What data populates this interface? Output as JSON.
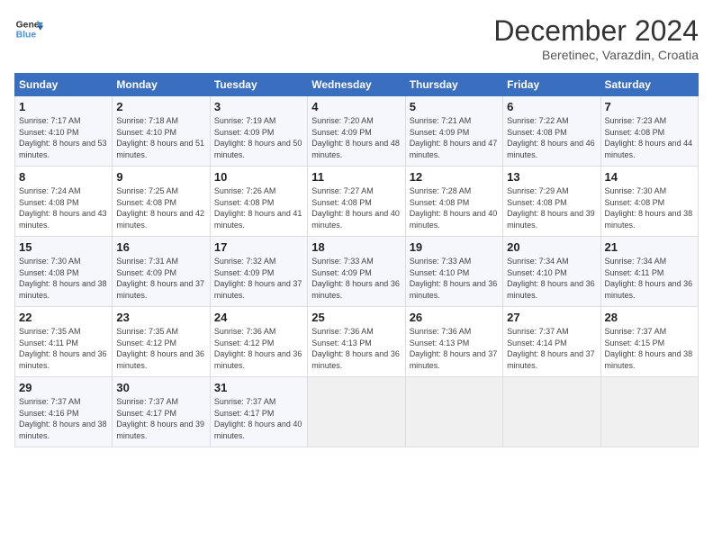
{
  "header": {
    "logo_line1": "General",
    "logo_line2": "Blue",
    "month": "December 2024",
    "location": "Beretinec, Varazdin, Croatia"
  },
  "weekdays": [
    "Sunday",
    "Monday",
    "Tuesday",
    "Wednesday",
    "Thursday",
    "Friday",
    "Saturday"
  ],
  "weeks": [
    [
      {
        "day": "1",
        "sunrise": "7:17 AM",
        "sunset": "4:10 PM",
        "daylight": "8 hours and 53 minutes."
      },
      {
        "day": "2",
        "sunrise": "7:18 AM",
        "sunset": "4:10 PM",
        "daylight": "8 hours and 51 minutes."
      },
      {
        "day": "3",
        "sunrise": "7:19 AM",
        "sunset": "4:09 PM",
        "daylight": "8 hours and 50 minutes."
      },
      {
        "day": "4",
        "sunrise": "7:20 AM",
        "sunset": "4:09 PM",
        "daylight": "8 hours and 48 minutes."
      },
      {
        "day": "5",
        "sunrise": "7:21 AM",
        "sunset": "4:09 PM",
        "daylight": "8 hours and 47 minutes."
      },
      {
        "day": "6",
        "sunrise": "7:22 AM",
        "sunset": "4:08 PM",
        "daylight": "8 hours and 46 minutes."
      },
      {
        "day": "7",
        "sunrise": "7:23 AM",
        "sunset": "4:08 PM",
        "daylight": "8 hours and 44 minutes."
      }
    ],
    [
      {
        "day": "8",
        "sunrise": "7:24 AM",
        "sunset": "4:08 PM",
        "daylight": "8 hours and 43 minutes."
      },
      {
        "day": "9",
        "sunrise": "7:25 AM",
        "sunset": "4:08 PM",
        "daylight": "8 hours and 42 minutes."
      },
      {
        "day": "10",
        "sunrise": "7:26 AM",
        "sunset": "4:08 PM",
        "daylight": "8 hours and 41 minutes."
      },
      {
        "day": "11",
        "sunrise": "7:27 AM",
        "sunset": "4:08 PM",
        "daylight": "8 hours and 40 minutes."
      },
      {
        "day": "12",
        "sunrise": "7:28 AM",
        "sunset": "4:08 PM",
        "daylight": "8 hours and 40 minutes."
      },
      {
        "day": "13",
        "sunrise": "7:29 AM",
        "sunset": "4:08 PM",
        "daylight": "8 hours and 39 minutes."
      },
      {
        "day": "14",
        "sunrise": "7:30 AM",
        "sunset": "4:08 PM",
        "daylight": "8 hours and 38 minutes."
      }
    ],
    [
      {
        "day": "15",
        "sunrise": "7:30 AM",
        "sunset": "4:08 PM",
        "daylight": "8 hours and 38 minutes."
      },
      {
        "day": "16",
        "sunrise": "7:31 AM",
        "sunset": "4:09 PM",
        "daylight": "8 hours and 37 minutes."
      },
      {
        "day": "17",
        "sunrise": "7:32 AM",
        "sunset": "4:09 PM",
        "daylight": "8 hours and 37 minutes."
      },
      {
        "day": "18",
        "sunrise": "7:33 AM",
        "sunset": "4:09 PM",
        "daylight": "8 hours and 36 minutes."
      },
      {
        "day": "19",
        "sunrise": "7:33 AM",
        "sunset": "4:10 PM",
        "daylight": "8 hours and 36 minutes."
      },
      {
        "day": "20",
        "sunrise": "7:34 AM",
        "sunset": "4:10 PM",
        "daylight": "8 hours and 36 minutes."
      },
      {
        "day": "21",
        "sunrise": "7:34 AM",
        "sunset": "4:11 PM",
        "daylight": "8 hours and 36 minutes."
      }
    ],
    [
      {
        "day": "22",
        "sunrise": "7:35 AM",
        "sunset": "4:11 PM",
        "daylight": "8 hours and 36 minutes."
      },
      {
        "day": "23",
        "sunrise": "7:35 AM",
        "sunset": "4:12 PM",
        "daylight": "8 hours and 36 minutes."
      },
      {
        "day": "24",
        "sunrise": "7:36 AM",
        "sunset": "4:12 PM",
        "daylight": "8 hours and 36 minutes."
      },
      {
        "day": "25",
        "sunrise": "7:36 AM",
        "sunset": "4:13 PM",
        "daylight": "8 hours and 36 minutes."
      },
      {
        "day": "26",
        "sunrise": "7:36 AM",
        "sunset": "4:13 PM",
        "daylight": "8 hours and 37 minutes."
      },
      {
        "day": "27",
        "sunrise": "7:37 AM",
        "sunset": "4:14 PM",
        "daylight": "8 hours and 37 minutes."
      },
      {
        "day": "28",
        "sunrise": "7:37 AM",
        "sunset": "4:15 PM",
        "daylight": "8 hours and 38 minutes."
      }
    ],
    [
      {
        "day": "29",
        "sunrise": "7:37 AM",
        "sunset": "4:16 PM",
        "daylight": "8 hours and 38 minutes."
      },
      {
        "day": "30",
        "sunrise": "7:37 AM",
        "sunset": "4:17 PM",
        "daylight": "8 hours and 39 minutes."
      },
      {
        "day": "31",
        "sunrise": "7:37 AM",
        "sunset": "4:17 PM",
        "daylight": "8 hours and 40 minutes."
      },
      null,
      null,
      null,
      null
    ]
  ]
}
